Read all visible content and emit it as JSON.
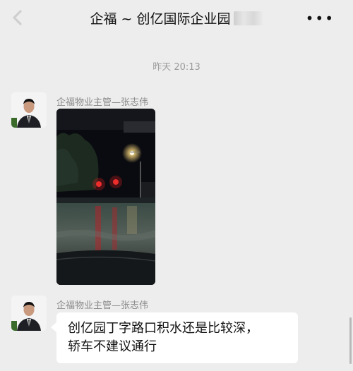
{
  "header": {
    "title": "企福 ~ 创亿国际企业园",
    "back_icon": "chevron-left-icon",
    "more_icon": "more-dots-icon",
    "more_glyph": "•••"
  },
  "timestamp": "昨天 20:13",
  "messages": [
    {
      "sender": "企福物业主管—张志伟",
      "type": "image"
    },
    {
      "sender": "企福物业主管—张志伟",
      "type": "text",
      "lines": [
        "创亿园丁字路口积水还是比较深，",
        "轿车不建议通行"
      ]
    }
  ],
  "colors": {
    "background": "#ededed",
    "bubble": "#ffffff",
    "name": "#8a8a8a",
    "time": "#9b9b9b"
  }
}
